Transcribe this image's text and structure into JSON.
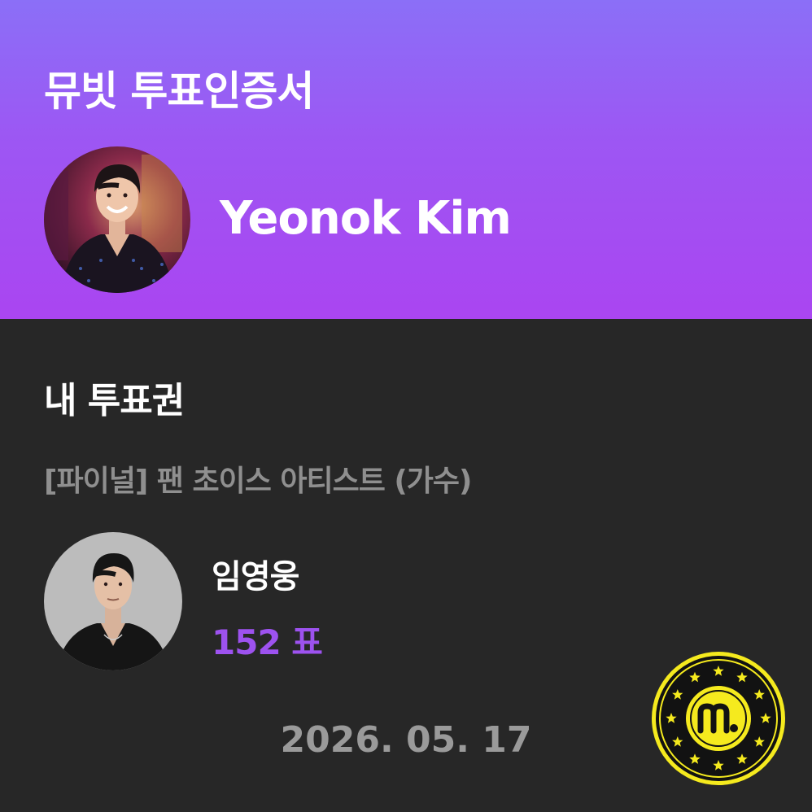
{
  "header": {
    "title": "뮤빗 투표인증서",
    "user_name": "Yeonok Kim",
    "gradient_top": "#8b6ff7",
    "gradient_bottom": "#aa45f1"
  },
  "ballot": {
    "section_title": "내 투표권",
    "category": "[파이널] 팬 초이스 아티스트 (가수)",
    "artist_name": "임영웅",
    "vote_count": "152 표",
    "vote_color": "#9d52ef",
    "date": "2026. 05. 17"
  },
  "seal": {
    "icon": "mubeat-seal-icon",
    "color": "#f5ea1e"
  }
}
